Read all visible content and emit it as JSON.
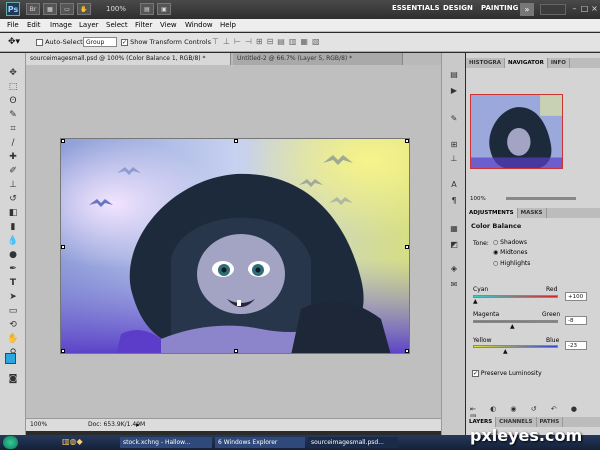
{
  "appbar": {
    "logo": "Ps",
    "zoom": "100%",
    "workspaces": [
      "ESSENTIALS",
      "DESIGN",
      "PAINTING"
    ],
    "more": "»"
  },
  "menu": [
    "File",
    "Edit",
    "Image",
    "Layer",
    "Select",
    "Filter",
    "View",
    "Window",
    "Help"
  ],
  "options": {
    "auto_select_label": "Auto-Select:",
    "auto_select_value": "Group",
    "show_transform_label": "Show Transform Controls"
  },
  "doc_tabs": [
    "sourceimagesmall.psd @ 100% (Color Balance 1, RGB/8) *",
    "Untitled-2 @ 66.7% (Layer 5, RGB/8) *"
  ],
  "status": {
    "zoom": "100%",
    "doc": "Doc: 653.9K/1.49M"
  },
  "panels": {
    "top_tabs": [
      "HISTOGRA",
      "NAVIGATOR",
      "INFO"
    ],
    "nav_zoom": "100%",
    "adj_tabs": [
      "ADJUSTMENTS",
      "MASKS"
    ],
    "adj_title": "Color Balance",
    "tone_label": "Tone:",
    "tones": [
      "Shadows",
      "Midtones",
      "Highlights"
    ],
    "sliders": [
      {
        "left": "Cyan",
        "right": "Red",
        "value": "+100"
      },
      {
        "left": "Magenta",
        "right": "Green",
        "value": "-8"
      },
      {
        "left": "Yellow",
        "right": "Blue",
        "value": "-23"
      }
    ],
    "preserve_label": "Preserve Luminosity",
    "bottom_tabs": [
      "LAYERS",
      "CHANNELS",
      "PATHS"
    ]
  },
  "taskbar": {
    "items": [
      "stock.xchng - Hallow...",
      "6 Windows Explorer",
      "sourceimagesmall.psd..."
    ]
  },
  "watermark": "pxleyes.com"
}
